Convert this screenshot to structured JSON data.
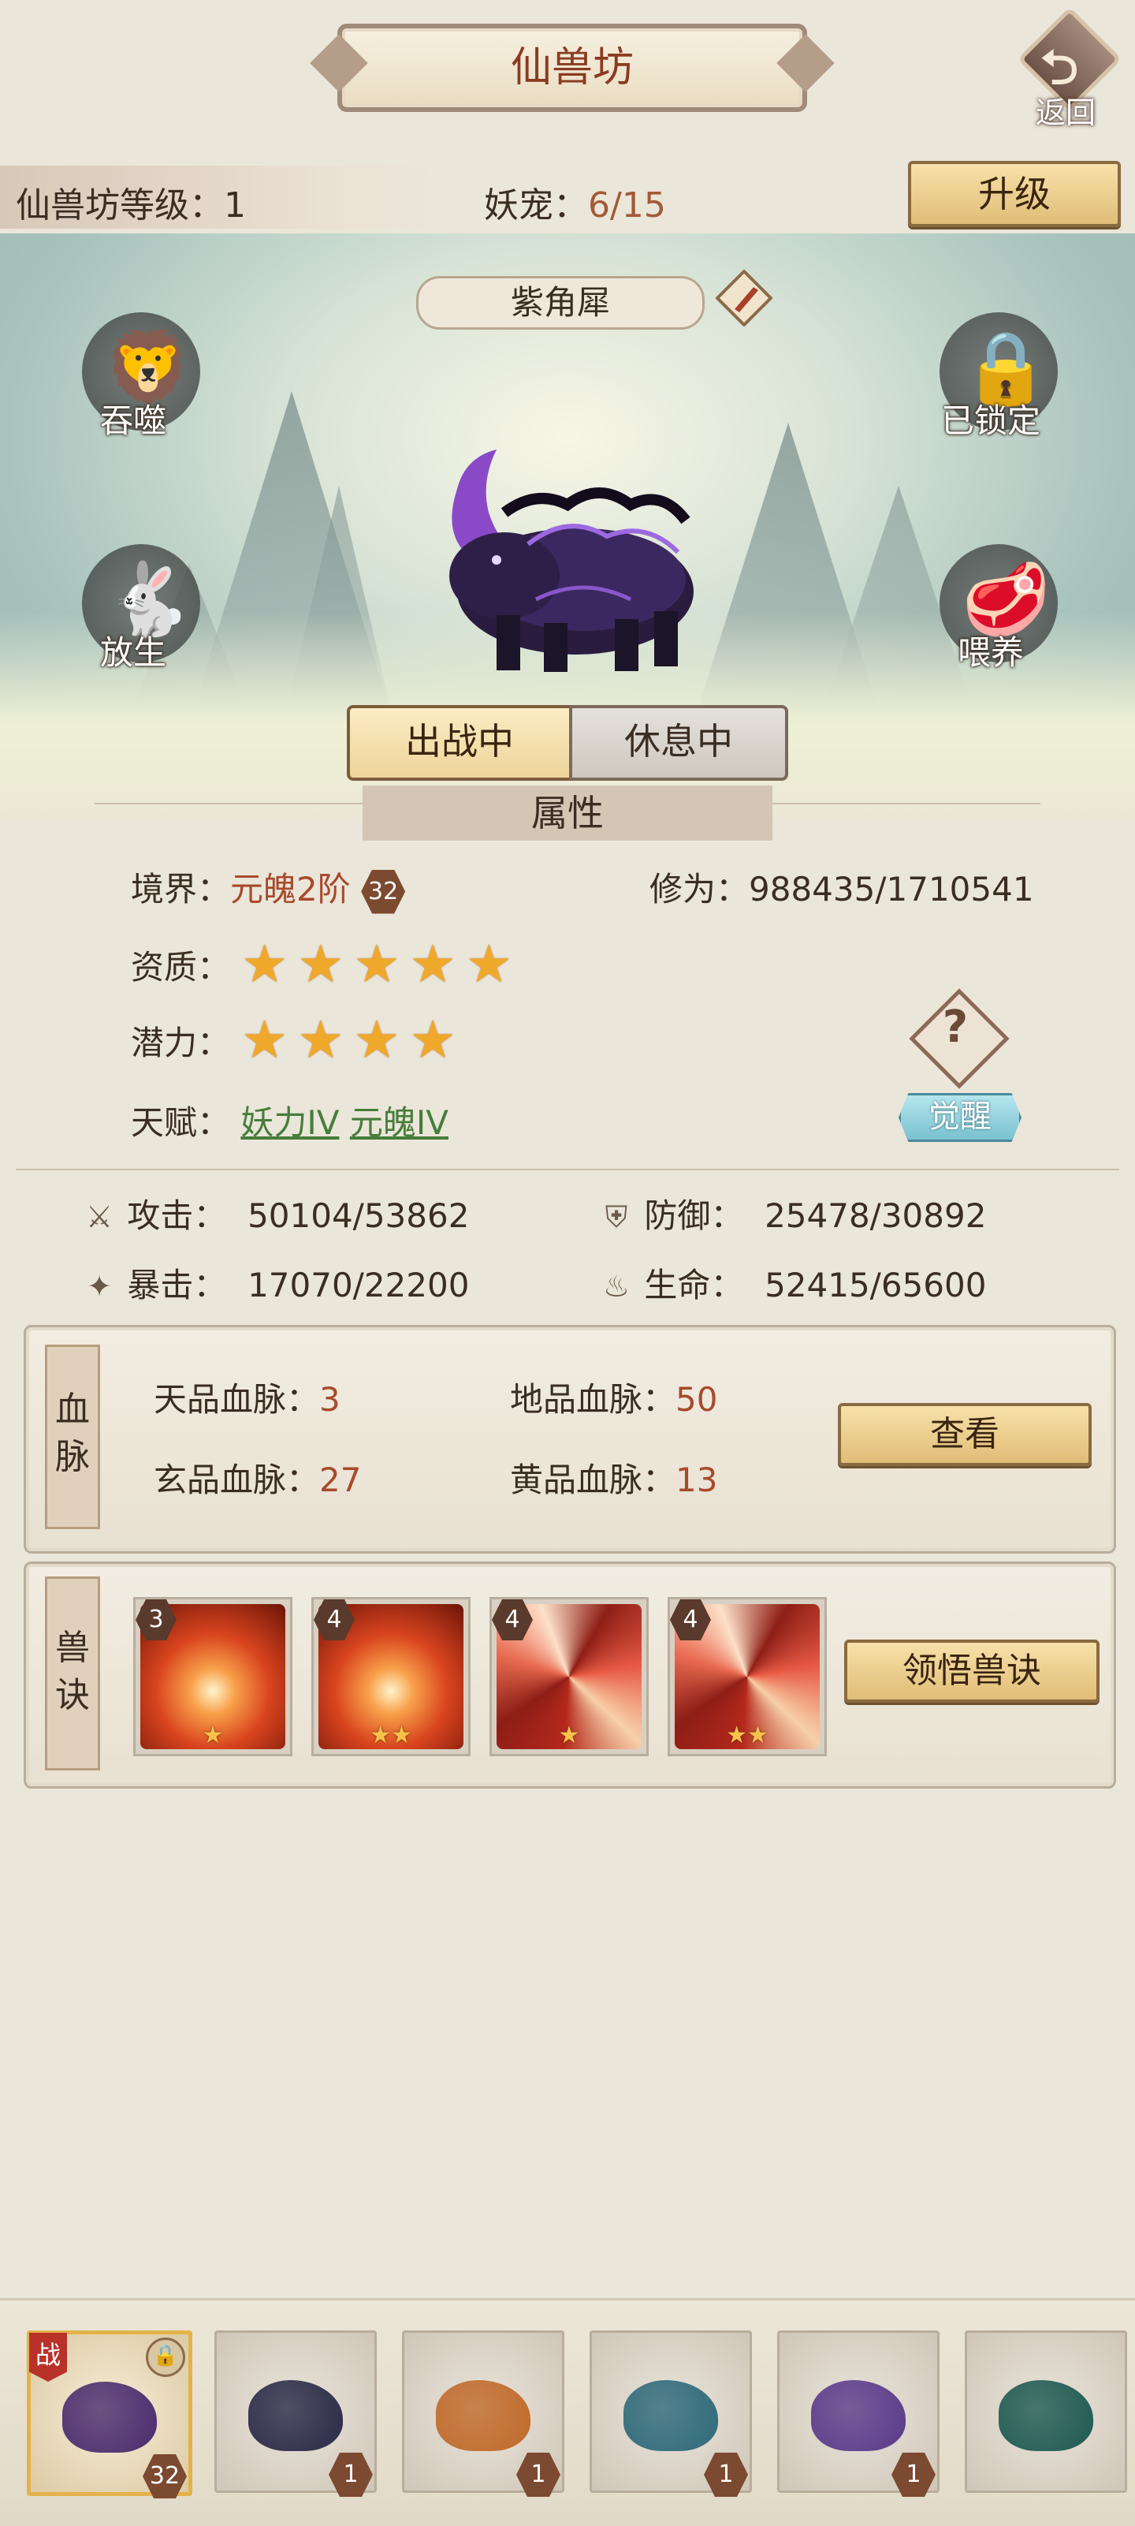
{
  "header": {
    "title": "仙兽坊",
    "back_label": "返回"
  },
  "level_bar": {
    "level_label": "仙兽坊等级：",
    "level_value": "1",
    "pet_label": "妖宠：",
    "pet_value": "6/15",
    "upgrade_label": "升级"
  },
  "pet": {
    "name": "紫角犀",
    "actions": {
      "devour": "吞噬",
      "locked": "已锁定",
      "release": "放生",
      "feed": "喂养"
    },
    "toggle": {
      "active": "出战中",
      "inactive": "休息中"
    }
  },
  "attributes": {
    "section_title": "属性",
    "realm_label": "境界：",
    "realm_value": "元魄2阶",
    "realm_level": "32",
    "cultivation_label": "修为：",
    "cultivation_value": "988435/1710541",
    "aptitude_label": "资质：",
    "aptitude_stars": 5,
    "potential_label": "潜力：",
    "potential_stars": 4,
    "talent_label": "天赋：",
    "talents": [
      "妖力IV",
      "元魄IV"
    ],
    "awaken_label": "觉醒",
    "help_icon": "?"
  },
  "stats": {
    "attack_label": "攻击：",
    "attack_value": "50104/53862",
    "defense_label": "防御：",
    "defense_value": "25478/30892",
    "crit_label": "暴击：",
    "crit_value": "17070/22200",
    "hp_label": "生命：",
    "hp_value": "52415/65600"
  },
  "bloodline": {
    "label": "血脉",
    "tian_label": "天品血脉：",
    "tian_value": "3",
    "di_label": "地品血脉：",
    "di_value": "50",
    "xuan_label": "玄品血脉：",
    "xuan_value": "27",
    "huang_label": "黄品血脉：",
    "huang_value": "13",
    "view_label": "查看"
  },
  "skills": {
    "label": "兽诀",
    "items": [
      {
        "level": "3",
        "stars": "★",
        "type": "fire"
      },
      {
        "level": "4",
        "stars": "★★",
        "type": "fire"
      },
      {
        "level": "4",
        "stars": "★",
        "type": "swirl"
      },
      {
        "level": "4",
        "stars": "★★",
        "type": "swirl"
      }
    ],
    "learn_label": "领悟兽诀"
  },
  "bottom_pets": [
    {
      "level": "32",
      "active": true,
      "battle_tag": "战",
      "color": "#4a2c6e"
    },
    {
      "level": "1",
      "active": false,
      "color": "#2a2a48"
    },
    {
      "level": "1",
      "active": false,
      "color": "#c06a2a"
    },
    {
      "level": "1",
      "active": false,
      "color": "#2e6a7a"
    },
    {
      "level": "1",
      "active": false,
      "color": "#5a3a8a"
    },
    {
      "level": "",
      "active": false,
      "color": "#1e5a52"
    }
  ],
  "colors": {
    "accent_red": "#a84a2c",
    "talent_green": "#477d3a",
    "gold_button": "#e0bd77"
  }
}
